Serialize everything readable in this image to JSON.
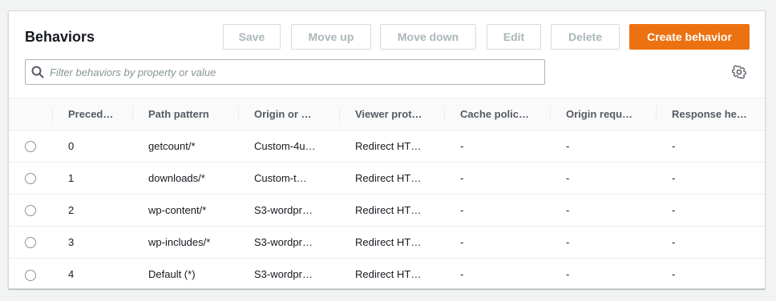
{
  "panel": {
    "title": "Behaviors"
  },
  "toolbar": {
    "save_label": "Save",
    "move_up_label": "Move up",
    "move_down_label": "Move down",
    "edit_label": "Edit",
    "delete_label": "Delete",
    "create_label": "Create behavior"
  },
  "search": {
    "placeholder": "Filter behaviors by property or value",
    "value": ""
  },
  "table": {
    "columns": [
      "Preced…",
      "Path pattern",
      "Origin or …",
      "Viewer prot…",
      "Cache polic…",
      "Origin requ…",
      "Response he…"
    ],
    "rows": [
      [
        "0",
        "getcount/*",
        "Custom-4u…",
        "Redirect HT…",
        "-",
        "-",
        "-"
      ],
      [
        "1",
        "downloads/*",
        "Custom-t…",
        "Redirect HT…",
        "-",
        "-",
        "-"
      ],
      [
        "2",
        "wp-content/*",
        "S3-wordpr…",
        "Redirect HT…",
        "-",
        "-",
        "-"
      ],
      [
        "3",
        "wp-includes/*",
        "S3-wordpr…",
        "Redirect HT…",
        "-",
        "-",
        "-"
      ],
      [
        "4",
        "Default (*)",
        "S3-wordpr…",
        "Redirect HT…",
        "-",
        "-",
        "-"
      ]
    ]
  },
  "colors": {
    "primary": "#ec7211",
    "disabled_text": "#aab7b8",
    "page_bg": "#f2f3f3"
  },
  "icons": {
    "search": "search-icon",
    "settings": "gear-icon"
  }
}
